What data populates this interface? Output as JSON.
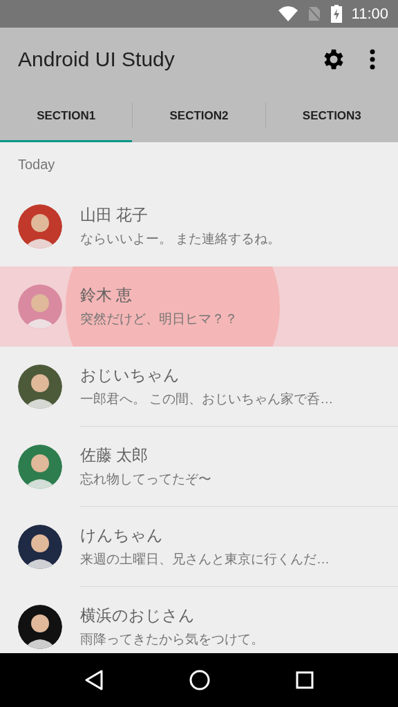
{
  "status_bar": {
    "time": "11:00"
  },
  "toolbar": {
    "title": "Android UI Study"
  },
  "tabs": [
    {
      "label": "SECTION1",
      "selected": true
    },
    {
      "label": "SECTION2",
      "selected": false
    },
    {
      "label": "SECTION3",
      "selected": false
    }
  ],
  "section_header": "Today",
  "contacts": [
    {
      "name": "山田 花子",
      "message": "ならいいよー。 また連絡するね。",
      "pressed": false,
      "color": "#c0392b"
    },
    {
      "name": "鈴木 恵",
      "message": "突然だけど、明日ヒマ？？",
      "pressed": true,
      "color": "#d98aa0"
    },
    {
      "name": "おじいちゃん",
      "message": "一郎君へ。 この間、おじいちゃん家で呑…",
      "pressed": false,
      "color": "#4d5a3a"
    },
    {
      "name": "佐藤 太郎",
      "message": "忘れ物してってたぞ〜",
      "pressed": false,
      "color": "#2e7d4f"
    },
    {
      "name": "けんちゃん",
      "message": "来週の土曜日、兄さんと東京に行くんだ…",
      "pressed": false,
      "color": "#1f2a44"
    },
    {
      "name": "横浜のおじさん",
      "message": "雨降ってきたから気をつけて。",
      "pressed": false,
      "color": "#111111"
    }
  ]
}
